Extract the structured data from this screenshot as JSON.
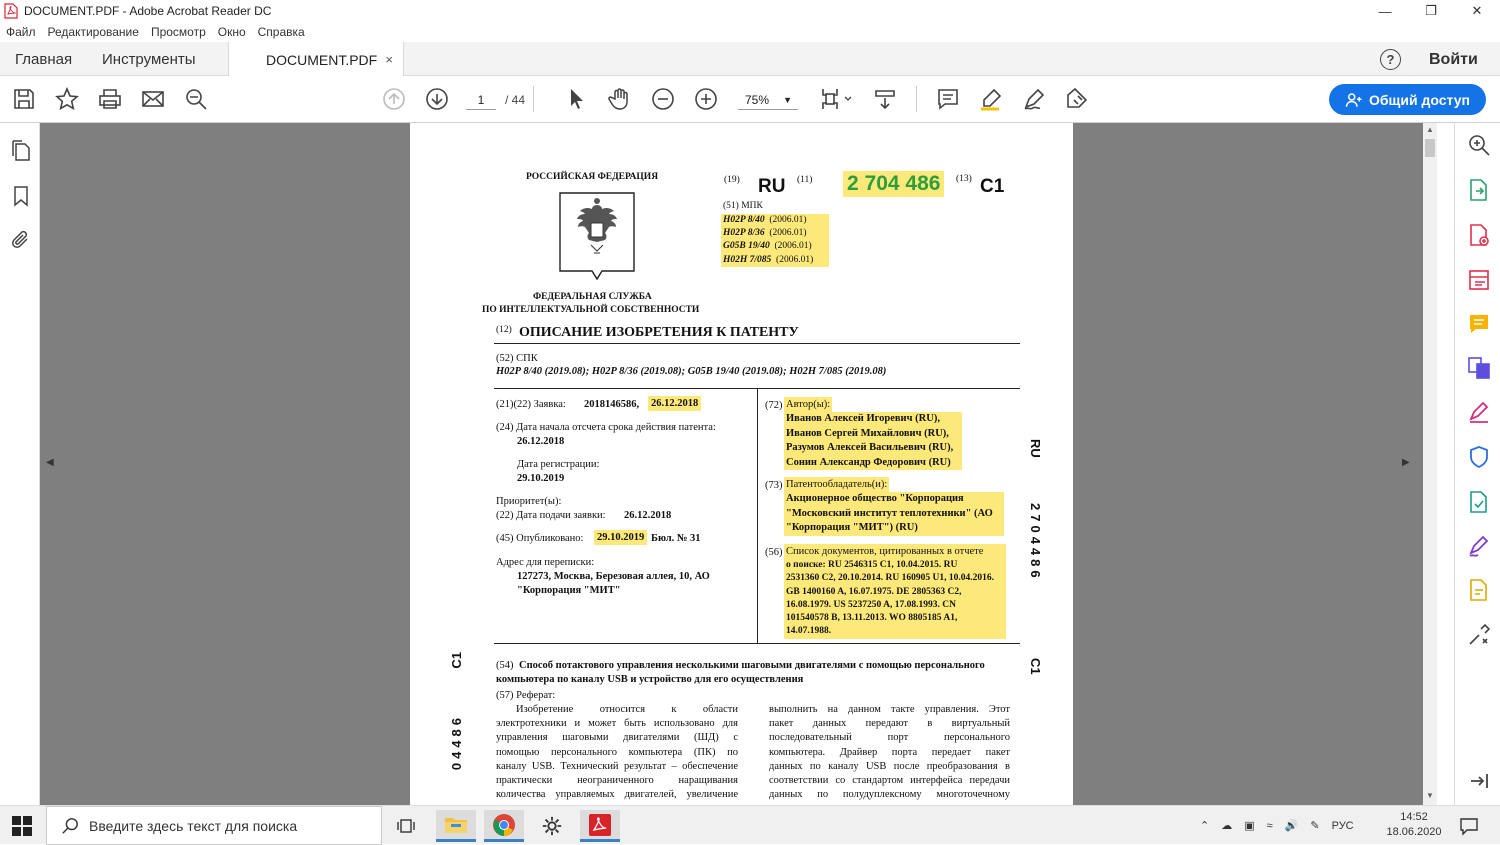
{
  "window": {
    "title": "DOCUMENT.PDF - Adobe Acrobat Reader DC"
  },
  "menu": [
    "Файл",
    "Редактирование",
    "Просмотр",
    "Окно",
    "Справка"
  ],
  "tabs": {
    "home": "Главная",
    "tools": "Инструменты",
    "document": "DOCUMENT.PDF",
    "close": "×",
    "help": "?",
    "login": "Войти"
  },
  "toolbar": {
    "page_current": "1",
    "page_total": "/ 44",
    "zoom": "75%",
    "share_label": "Общий доступ"
  },
  "document": {
    "federation": "РОССИЙСКАЯ ФЕДЕРАЦИЯ",
    "code19": "(19)",
    "country": "RU",
    "code11": "(11)",
    "number": "2 704 486",
    "code13": "(13)",
    "kind": "C1",
    "mpk_label": "(51)  МПК",
    "mpk": [
      {
        "code": "H02P 8/40",
        "date": "(2006.01)"
      },
      {
        "code": "H02P 8/36",
        "date": "(2006.01)"
      },
      {
        "code": "G05B 19/40",
        "date": "(2006.01)"
      },
      {
        "code": "H02H 7/085",
        "date": "(2006.01)"
      }
    ],
    "agency_line1": "ФЕДЕРАЛЬНАЯ СЛУЖБА",
    "agency_line2": "ПО ИНТЕЛЛЕКТУАЛЬНОЙ СОБСТВЕННОСТИ",
    "code12": "(12)",
    "doc_title": "ОПИСАНИЕ ИЗОБРЕТЕНИЯ К ПАТЕНТУ",
    "spk_label": "(52) СПК",
    "spk_values": "H02P 8/40 (2019.08); H02P 8/36 (2019.08); G05B 19/40 (2019.08); H02H 7/085 (2019.08)",
    "app_label": "(21)(22) Заявка:",
    "app_number": "2018146586,",
    "app_date": "26.12.2018",
    "term_label": "(24) Дата начала отсчета срока действия патента:",
    "term_date": "26.12.2018",
    "reg_label": "Дата регистрации:",
    "reg_date": "29.10.2019",
    "priority_label": "Приоритет(ы):",
    "filing_label": "(22) Дата подачи заявки:",
    "filing_date": "26.12.2018",
    "pub_label": "(45) Опубликовано:",
    "pub_date": "29.10.2019",
    "pub_bul": "Бюл. № 31",
    "address_label": "Адрес для переписки:",
    "address_line1": "127273, Москва, Березовая аллея, 10, АО",
    "address_line2": "\"Корпорация \"МИТ\"",
    "authors_code": "(72)",
    "authors_label": "Автор(ы):",
    "authors": [
      "Иванов Алексей Игоревич (RU),",
      "Иванов Сергей Михайлович (RU),",
      "Разумов Алексей Васильевич (RU),",
      "Сонин Александр Федорович (RU)"
    ],
    "owner_code": "(73)",
    "owner_label": "Патентообладатель(и):",
    "owner_lines": [
      "Акционерное общество \"Корпорация",
      "\"Московский институт теплотехники\" (АО",
      "\"Корпорация \"МИТ\") (RU)"
    ],
    "refs_code": "(56)",
    "refs_label": "Список документов, цитированных в отчете",
    "refs_lines": [
      "о поиске:  RU 2546315 C1, 10.04.2015. RU",
      "2531360 C2, 20.10.2014. RU 160905 U1, 10.04.2016.",
      "GB 1400160 A, 16.07.1975. DE 2805363 C2,",
      "16.08.1979. US 5237250 A, 17.08.1993. CN",
      "101540578 B, 13.11.2013. WO 8805185 A1,",
      "14.07.1988."
    ],
    "side_right_top": "RU",
    "side_right_number": "2704486",
    "side_right_kind": "C1",
    "side_left_kind": "C1",
    "side_left_number": "04486",
    "code54": "(54)",
    "invention_title_line1": "Способ потактового управления несколькими шаговыми двигателями с помощью персонального",
    "invention_title_line2": "компьютера по каналу USB и устройство для его осуществления",
    "abstract_label": "(57)  Реферат:",
    "abstract_left": [
      "Изобретение      относится      к      области",
      "электротехники и может быть использовано для",
      "управления   шаговыми   двигателями   (ШД)   с",
      "помощью персонального компьютера (ПК) по",
      "каналу USB. Технический результат – обеспечение",
      "практически    неограниченного    наращивания",
      "количества управляемых двигателей, увеличение"
    ],
    "abstract_right": [
      "выполнить на данном такте управления. Этот",
      "пакет   данных   передают   в   виртуальный",
      "последовательный     порт     персонального",
      "компьютера. Драйвер порта передает пакет",
      "данных по каналу USB после преобразования в",
      "соответствии со стандартом интерфейса передачи",
      "данных  по  полудуплексному  многоточечному"
    ]
  },
  "taskbar": {
    "search_placeholder": "Введите здесь текст для поиска",
    "lang": "РУС",
    "time": "14:52",
    "date": "18.06.2020"
  },
  "colors": {
    "accent": "#1473e6",
    "highlight": "#fde97a",
    "patent_number": "#2e9d3d",
    "viewer_bg": "#7f7f7f"
  }
}
